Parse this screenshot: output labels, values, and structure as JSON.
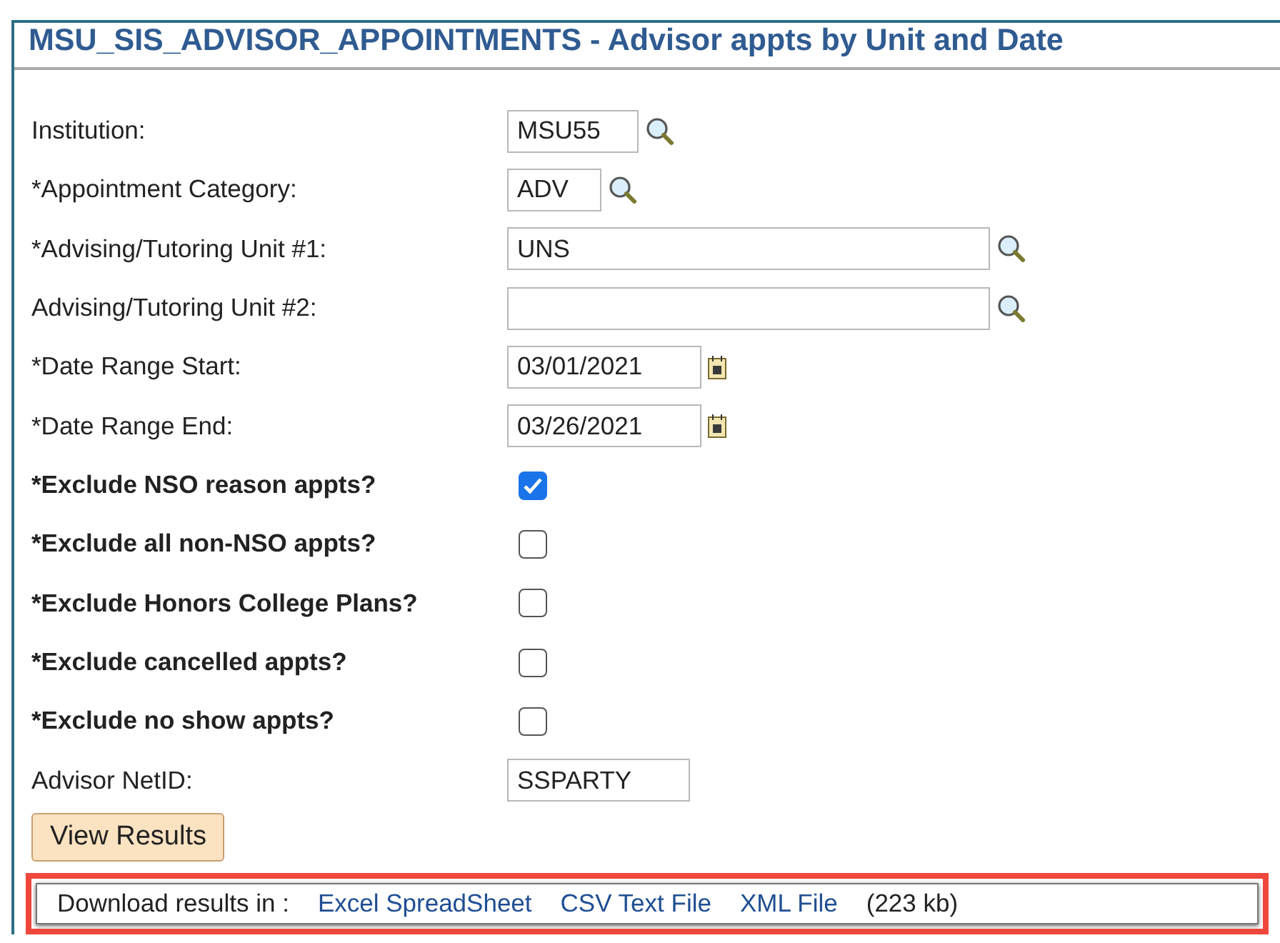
{
  "page_title": "MSU_SIS_ADVISOR_APPOINTMENTS - Advisor appts by Unit and Date",
  "fields": [
    {
      "kind": "lookup",
      "label": "Institution:",
      "value": "MSU55"
    },
    {
      "kind": "lookup",
      "label": "*Appointment Category:",
      "value": "ADV"
    },
    {
      "kind": "lookup",
      "label": "*Advising/Tutoring Unit #1:",
      "value": "UNS"
    },
    {
      "kind": "lookup",
      "label": "Advising/Tutoring Unit #2:"
    },
    {
      "kind": "date",
      "label": "*Date Range Start:",
      "value": "03/01/2021"
    },
    {
      "kind": "date",
      "label": "*Date Range End:",
      "value": "03/26/2021"
    },
    {
      "kind": "checkbox",
      "label": "*Exclude NSO reason appts?",
      "checked": true
    },
    {
      "kind": "checkbox",
      "label": "*Exclude all non-NSO appts?",
      "checked": false
    },
    {
      "kind": "checkbox",
      "label": "*Exclude Honors College Plans?",
      "checked": false
    },
    {
      "kind": "checkbox",
      "label": "*Exclude cancelled appts?",
      "checked": false
    },
    {
      "kind": "checkbox",
      "label": "*Exclude no show appts?",
      "checked": false
    },
    {
      "kind": "text",
      "label": "Advisor NetID:",
      "value": "SSPARTY"
    }
  ],
  "view_button": "View Results",
  "download": {
    "label": "Download results in :",
    "links": [
      "Excel SpreadSheet",
      "CSV Text File",
      "XML File"
    ],
    "size": "(223 kb)"
  }
}
